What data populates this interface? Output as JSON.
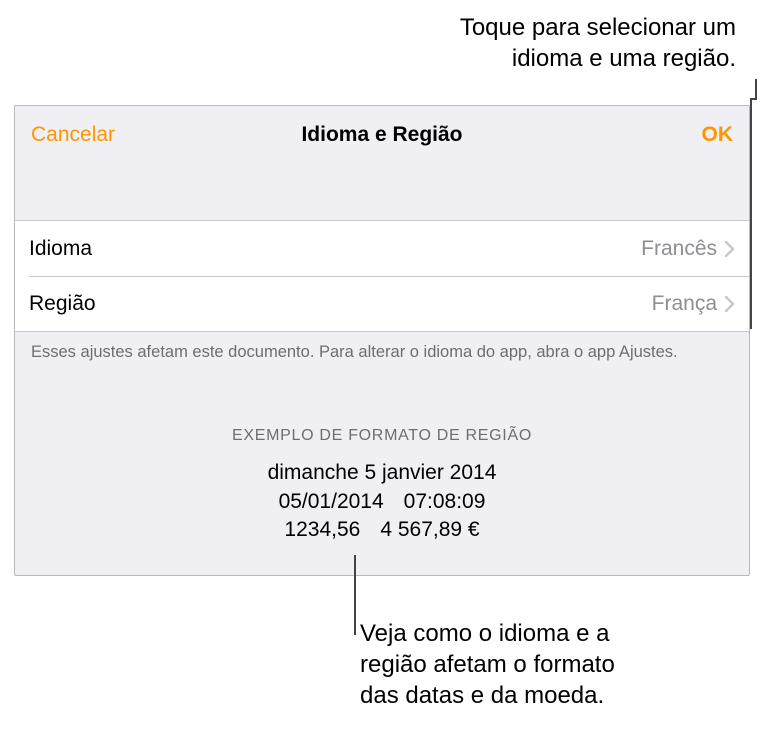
{
  "callouts": {
    "top_line1": "Toque para selecionar um",
    "top_line2": "idioma e uma região.",
    "bottom_line1": "Veja como o idioma e a",
    "bottom_line2": "região afetam o formato",
    "bottom_line3": "das datas e da moeda."
  },
  "nav": {
    "cancel": "Cancelar",
    "title": "Idioma e Região",
    "ok": "OK"
  },
  "rows": {
    "language": {
      "label": "Idioma",
      "value": "Francês"
    },
    "region": {
      "label": "Região",
      "value": "França"
    }
  },
  "footer": "Esses ajustes afetam este documento. Para alterar o idioma do app, abra o app Ajustes.",
  "example": {
    "header": "EXEMPLO DE FORMATO DE REGIÃO",
    "long_date": "dimanche 5 janvier 2014",
    "short_date": "05/01/2014",
    "time": "07:08:09",
    "number": "1234,56",
    "currency": "4 567,89 €"
  }
}
